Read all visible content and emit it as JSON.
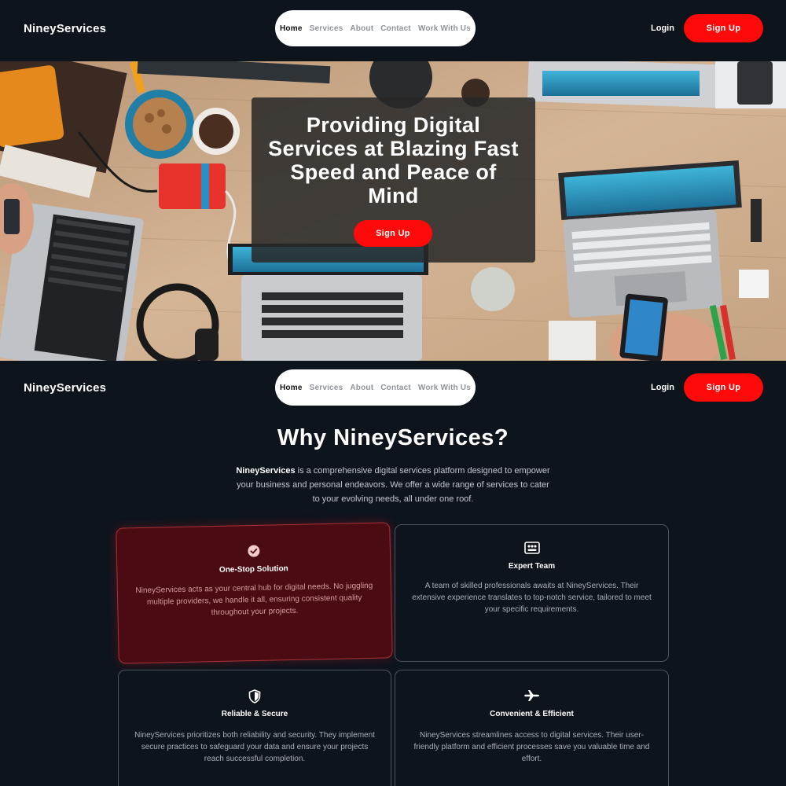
{
  "brand": "NineyServices",
  "nav": {
    "links": [
      "Home",
      "Services",
      "About",
      "Contact",
      "Work With Us"
    ],
    "active": "Home",
    "login": "Login",
    "signup": "Sign Up"
  },
  "hero": {
    "title": "Providing Digital Services at Blazing Fast Speed and Peace of Mind",
    "cta": "Sign Up"
  },
  "why": {
    "title": "Why NineyServices?",
    "intro_brand": "NineyServices",
    "intro_rest": " is a comprehensive digital services platform designed to empower your business and personal endeavors. We offer a wide range of services to cater to your evolving needs, all under one roof."
  },
  "features": [
    {
      "icon": "check-circle-icon",
      "title": "One-Stop Solution",
      "desc": "NineyServices acts as your central hub for digital needs. No juggling multiple providers, we handle it all, ensuring consistent quality throughout your projects."
    },
    {
      "icon": "team-icon",
      "title": "Expert Team",
      "desc": "A team of skilled professionals awaits at NineyServices. Their extensive experience translates to top-notch service, tailored to meet your specific requirements."
    },
    {
      "icon": "shield-icon",
      "title": "Reliable & Secure",
      "desc": "NineyServices prioritizes both reliability and security. They implement secure practices to safeguard your data and ensure your projects reach successful completion."
    },
    {
      "icon": "airplane-icon",
      "title": "Convenient & Efficient",
      "desc": "NineyServices streamlines access to digital services. Their user-friendly platform and efficient processes save you valuable time and effort."
    }
  ],
  "colors": {
    "background": "#0e141c",
    "accent": "#ff0a0a",
    "highlight_card": "#4a0c12"
  }
}
